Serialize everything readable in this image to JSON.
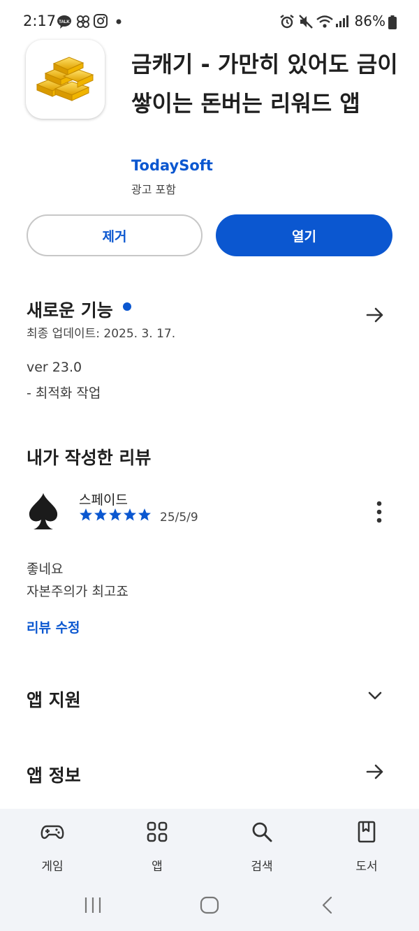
{
  "status_bar": {
    "time": "2:17",
    "battery": "86%"
  },
  "app": {
    "title": "금캐기 - 가만히 있어도 금이 쌓이는 돈버는 리워드 앱",
    "developer": "TodaySoft",
    "ads_note": "광고 포함",
    "uninstall_label": "제거",
    "open_label": "열기"
  },
  "whats_new": {
    "title": "새로운 기능",
    "last_updated": "최종 업데이트: 2025. 3. 17.",
    "version": "ver 23.0",
    "notes": "- 최적화 작업"
  },
  "my_review": {
    "title": "내가 작성한 리뷰",
    "reviewer": "스페이드",
    "rating": 5,
    "date": "25/5/9",
    "line1": "좋네요",
    "line2": "자본주의가 최고죠",
    "edit_label": "리뷰 수정"
  },
  "app_support": {
    "title": "앱 지원"
  },
  "app_info": {
    "title": "앱 정보"
  },
  "bottom_nav": {
    "games": "게임",
    "apps": "앱",
    "search": "검색",
    "books": "도서"
  },
  "colors": {
    "accent": "#0b57d0",
    "nav_bg": "#f2f4f8"
  }
}
